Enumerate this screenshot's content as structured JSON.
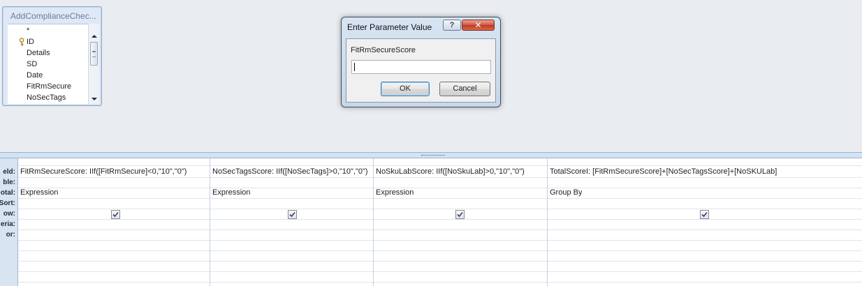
{
  "table_box": {
    "title": "AddComplianceChec...",
    "fields": [
      "*",
      "ID",
      "Details",
      "SD",
      "Date",
      "FitRmSecure",
      "NoSecTags"
    ]
  },
  "dialog": {
    "title": "Enter Parameter Value",
    "help_label": "?",
    "close_label": "✕",
    "parameter_name": "FitRmSecureScore",
    "input_value": "",
    "ok_label": "OK",
    "cancel_label": "Cancel"
  },
  "grid": {
    "row_labels": [
      "eld:",
      "ble:",
      "otal:",
      "Sort:",
      "ow:",
      "eria:",
      "or:"
    ],
    "columns": [
      {
        "field": "FitRmSecureScore: IIf([FitRmSecure]<0,\"10\",\"0\")",
        "total": "Expression",
        "show": true
      },
      {
        "field": "NoSecTagsScore: IIf([NoSecTags]>0,\"10\",\"0\")",
        "total": "Expression",
        "show": true
      },
      {
        "field": "NoSkuLabScore: IIf([NoSkuLab]>0,\"10\",\"0\")",
        "total": "Expression",
        "show": true
      },
      {
        "field": "TotalScoreI: [FitRmSecureScore]+[NoSecTagsScore]+[NoSKULab]",
        "total": "Group By",
        "show": true
      }
    ]
  }
}
